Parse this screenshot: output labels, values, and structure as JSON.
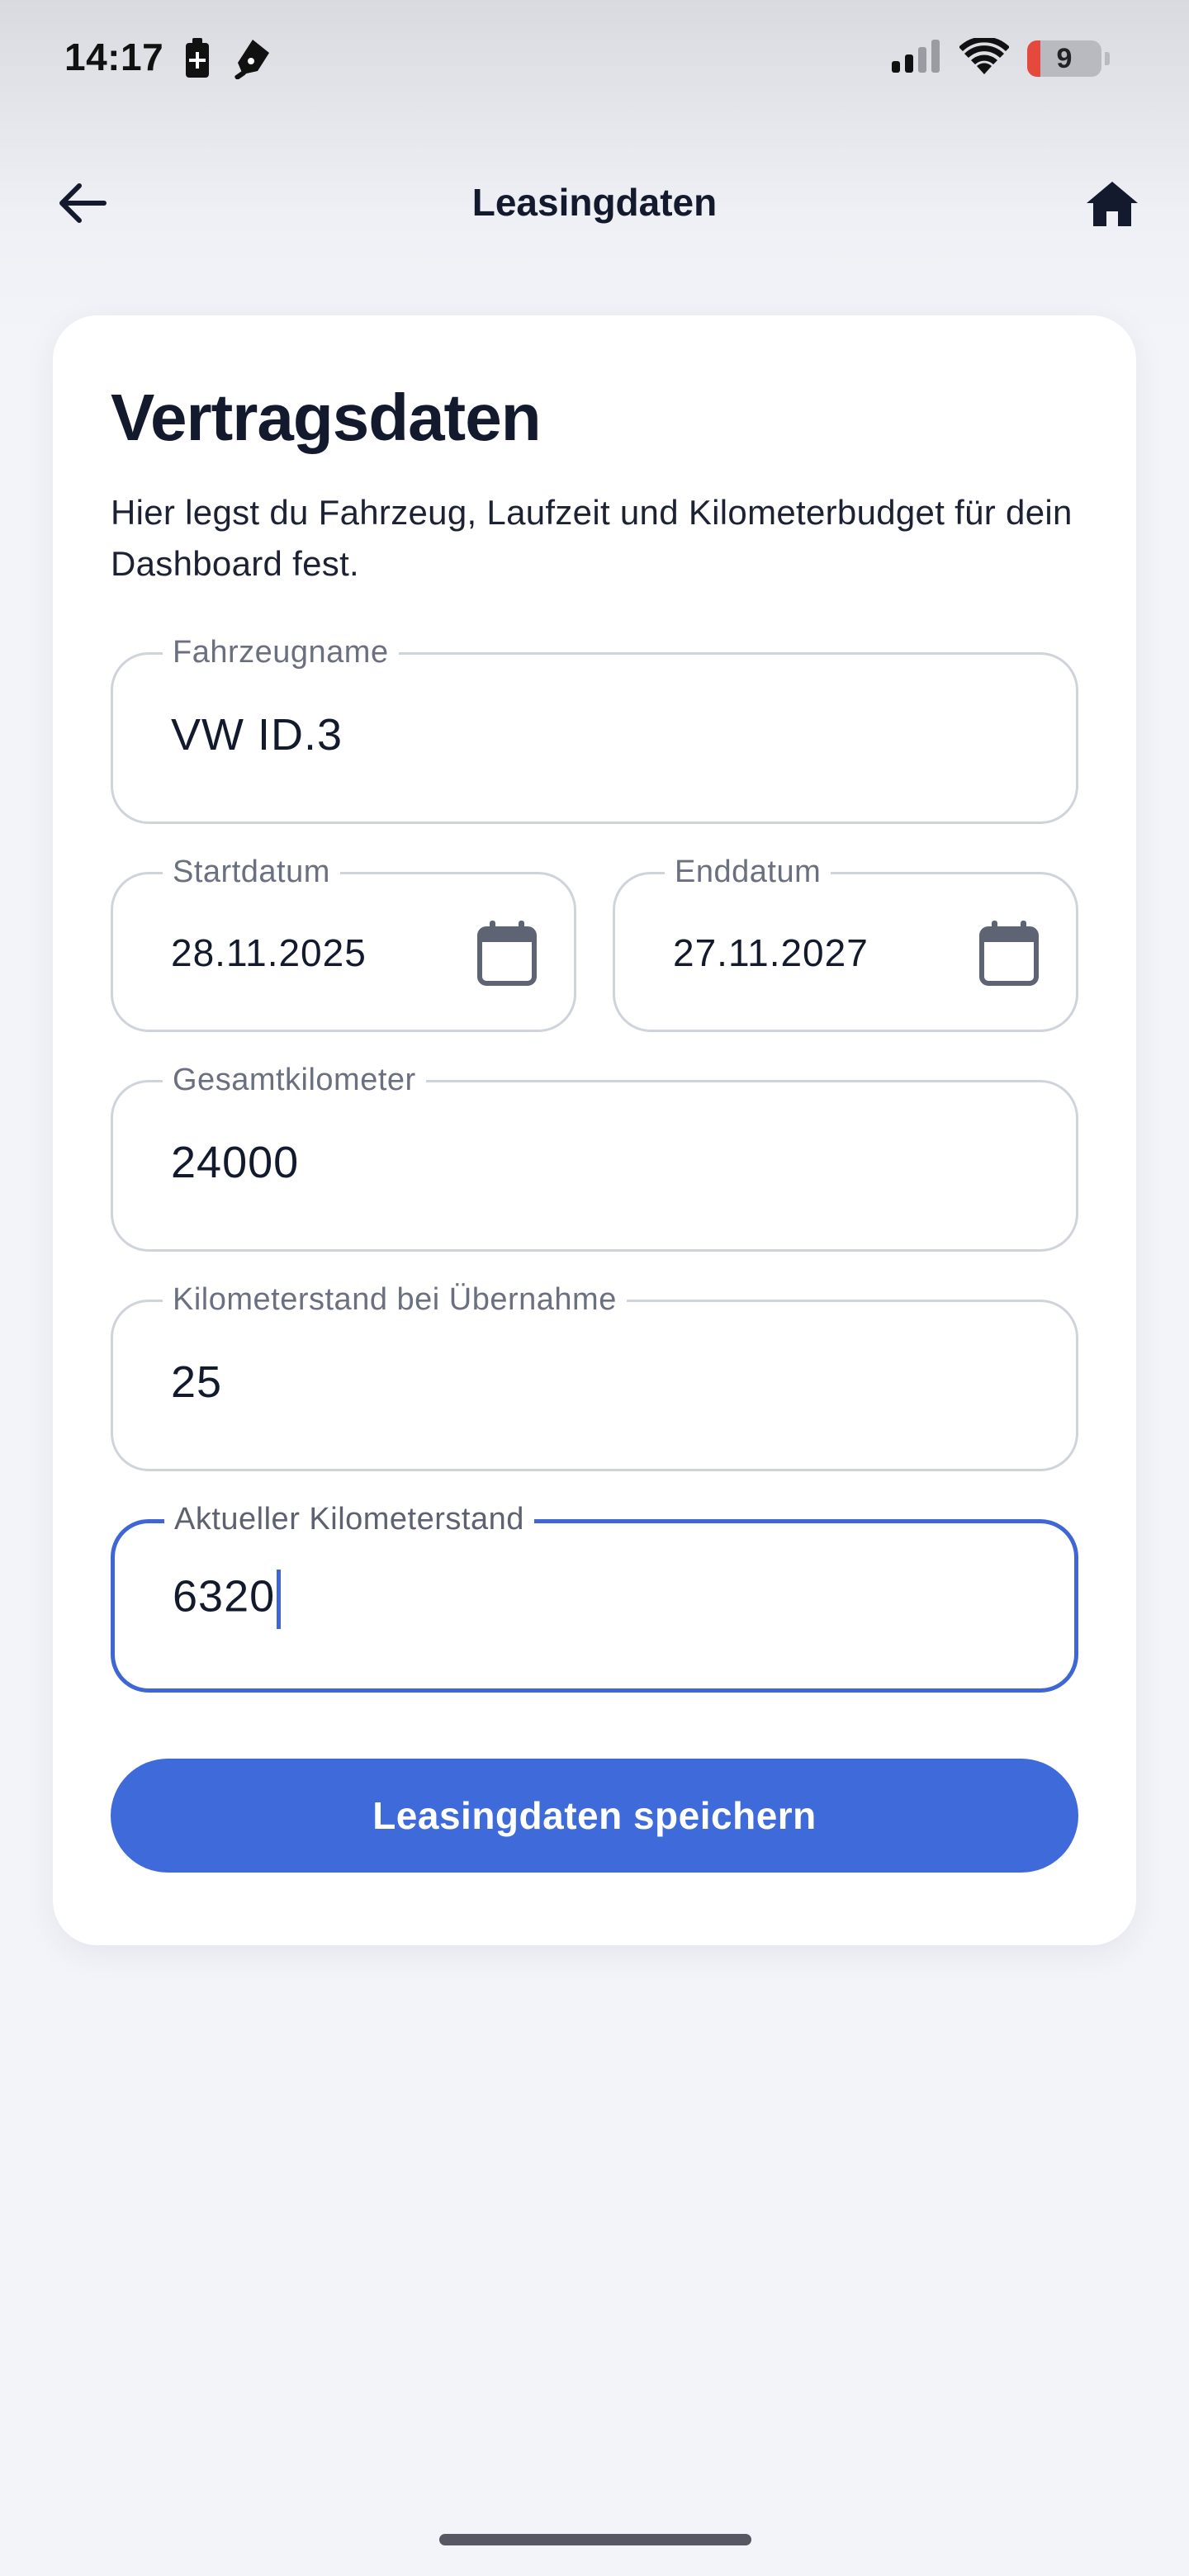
{
  "status_bar": {
    "time": "14:17",
    "icons_left": [
      "battery-saver-icon",
      "pen-icon"
    ],
    "icons_right": [
      "signal-icon",
      "wifi-icon",
      "battery-icon"
    ],
    "battery_level": "9",
    "battery_fraction": 0.09,
    "battery_low_color": "#e5483d"
  },
  "app_bar": {
    "title": "Leasingdaten",
    "back_icon": "arrow-left-icon",
    "home_icon": "home-icon"
  },
  "card": {
    "title": "Vertragsdaten",
    "description": "Hier legst du Fahrzeug, Laufzeit und Kilometerbudget für dein Dashboard fest."
  },
  "form": {
    "vehicle_name": {
      "label": "Fahrzeugname",
      "value": "VW ID.3"
    },
    "start_date": {
      "label": "Startdatum",
      "value": "28.11.2025",
      "icon": "calendar-icon"
    },
    "end_date": {
      "label": "Enddatum",
      "value": "27.11.2027",
      "icon": "calendar-icon"
    },
    "total_km": {
      "label": "Gesamtkilometer",
      "value": "24000"
    },
    "km_at_handover": {
      "label": "Kilometerstand bei Übernahme",
      "value": "25"
    },
    "current_km": {
      "label": "Aktueller Kilometerstand",
      "value": "6320",
      "focused": true
    }
  },
  "save_button": {
    "label": "Leasingdaten speichern"
  },
  "colors": {
    "accent": "#3f6bda",
    "text_dark": "#141a2e",
    "label_gray": "#6b7080",
    "field_border": "#cfd3db",
    "background": "#f3f4f9"
  }
}
